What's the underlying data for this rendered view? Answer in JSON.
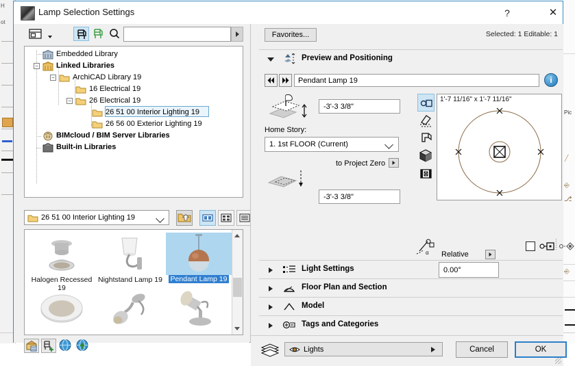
{
  "window": {
    "title": "Lamp Selection Settings",
    "app_icon": "archicad-lamp-icon",
    "help_label": "?",
    "close_label": "✕"
  },
  "left_pane": {
    "toolbar": {
      "list_view_icon": "list-layout-icon",
      "chair_black_icon": "object-chair-icon",
      "chair_green_icon": "object-chair-green-icon",
      "search_icon": "search-icon",
      "search_value": "",
      "search_placeholder": "",
      "search_go_icon": "play-arrow-icon"
    },
    "tree": {
      "items": [
        {
          "label": "Embedded Library",
          "icon": "embedded-library-icon",
          "depth": 1,
          "bold": false,
          "expander": "",
          "selected": false
        },
        {
          "label": "Linked Libraries",
          "icon": "linked-libraries-icon",
          "depth": 0,
          "bold": true,
          "expander": "-",
          "selected": false
        },
        {
          "label": "ArchiCAD Library 19",
          "icon": "folder-icon",
          "depth": 1,
          "bold": false,
          "expander": "-",
          "selected": false
        },
        {
          "label": "16 Electrical 19",
          "icon": "folder-icon",
          "depth": 2,
          "bold": false,
          "expander": "",
          "selected": false
        },
        {
          "label": "26 Electrical 19",
          "icon": "folder-icon",
          "depth": 2,
          "bold": false,
          "expander": "-",
          "selected": false
        },
        {
          "label": "26 51 00 Interior Lighting 19",
          "icon": "folder-icon",
          "depth": 3,
          "bold": false,
          "expander": "",
          "selected": true
        },
        {
          "label": "26 56 00 Exterior Lighting 19",
          "icon": "folder-icon",
          "depth": 3,
          "bold": false,
          "expander": "",
          "selected": false
        },
        {
          "label": "BIMcloud / BIM Server Libraries",
          "icon": "bimcloud-icon",
          "depth": 0,
          "bold": true,
          "expander": "",
          "selected": false
        },
        {
          "label": "Built-in Libraries",
          "icon": "builtin-library-icon",
          "depth": 0,
          "bold": true,
          "expander": "",
          "selected": false
        }
      ]
    },
    "folder_bar": {
      "current_folder": "26 51 00 Interior Lighting 19",
      "up_icon": "folder-up-icon",
      "view_large_icon": "view-large-tiles-icon",
      "view_grid_icon": "view-grid-icon",
      "view_list_icon": "view-list-icon"
    },
    "thumbnails": [
      {
        "label": "Halogen Recessed 19",
        "art": "halogen-recessed-lamp",
        "selected": false
      },
      {
        "label": "Nightstand Lamp 19",
        "art": "nightstand-lamp",
        "selected": false
      },
      {
        "label": "Pendant Lamp 19",
        "art": "pendant-lamp",
        "selected": true
      },
      {
        "label": "",
        "art": "ceiling-disc-lamp",
        "selected": false
      },
      {
        "label": "",
        "art": "wall-spot-lamp",
        "selected": false
      },
      {
        "label": "",
        "art": "floor-spot-lamp",
        "selected": false
      }
    ],
    "bottom_icons": [
      "library-manager-icon",
      "add-object-icon",
      "globe-icon",
      "globe-download-icon"
    ]
  },
  "right_pane": {
    "favorites_label": "Favorites...",
    "selection_status": "Selected: 1 Editable: 1",
    "preview_section": {
      "title": "Preview and Positioning",
      "icon": "preview-positioning-icon",
      "expanded": true,
      "prev_icon": "nav-prev-icon",
      "next_icon": "nav-next-icon",
      "object_name": "Pendant Lamp 19",
      "info_icon": "info-icon",
      "elevation_icon": "elevation-to-story-icon",
      "elevation_value": "-3'-3 3/8\"",
      "home_story_label": "Home Story:",
      "home_story_value": "1. 1st FLOOR (Current)",
      "to_project_zero_label": "to Project Zero",
      "project_zero_icon": "elevation-to-zero-icon",
      "project_zero_value": "-3'-3 3/8\"",
      "view_icons": [
        "2d-symbol-icon",
        "3d-front-view-icon",
        "3d-axon-view-icon",
        "3d-preview-icon",
        "note-preview-icon"
      ],
      "preview_dimensions": "1'-7 11/16\" x 1'-7 11/16\"",
      "rotation_label": "Relative",
      "rotation_expand_icon": "play-arrow-icon",
      "rotation_icon": "rotation-angle-icon",
      "rotation_value": "0.00°",
      "mirror_checkbox_checked": false,
      "anchor_icon": "anchor-point-icon",
      "gravity_icon": "gravity-icon"
    },
    "sections": [
      {
        "title": "Light Settings",
        "icon": "light-settings-icon",
        "expanded": false
      },
      {
        "title": "Floor Plan and Section",
        "icon": "floor-plan-section-icon",
        "expanded": false
      },
      {
        "title": "Model",
        "icon": "model-icon",
        "expanded": false
      },
      {
        "title": "Tags and Categories",
        "icon": "tags-categories-icon",
        "expanded": false
      }
    ],
    "footer": {
      "layers_icon": "layers-icon",
      "layer_name": "Lights",
      "layer_eye_icon": "eye-icon",
      "layer_arrow_icon": "play-arrow-icon",
      "cancel_label": "Cancel",
      "ok_label": "OK"
    }
  },
  "background": {
    "ruler_labels": [
      "H",
      "ot"
    ],
    "right_label": "Pic"
  },
  "colors": {
    "accent_blue": "#2a7fc9",
    "selection_blue": "#2f7fd0",
    "selection_light": "#cde5f5",
    "dialog_bg": "#f0f0f0",
    "window_border": "#3b8bbd"
  }
}
